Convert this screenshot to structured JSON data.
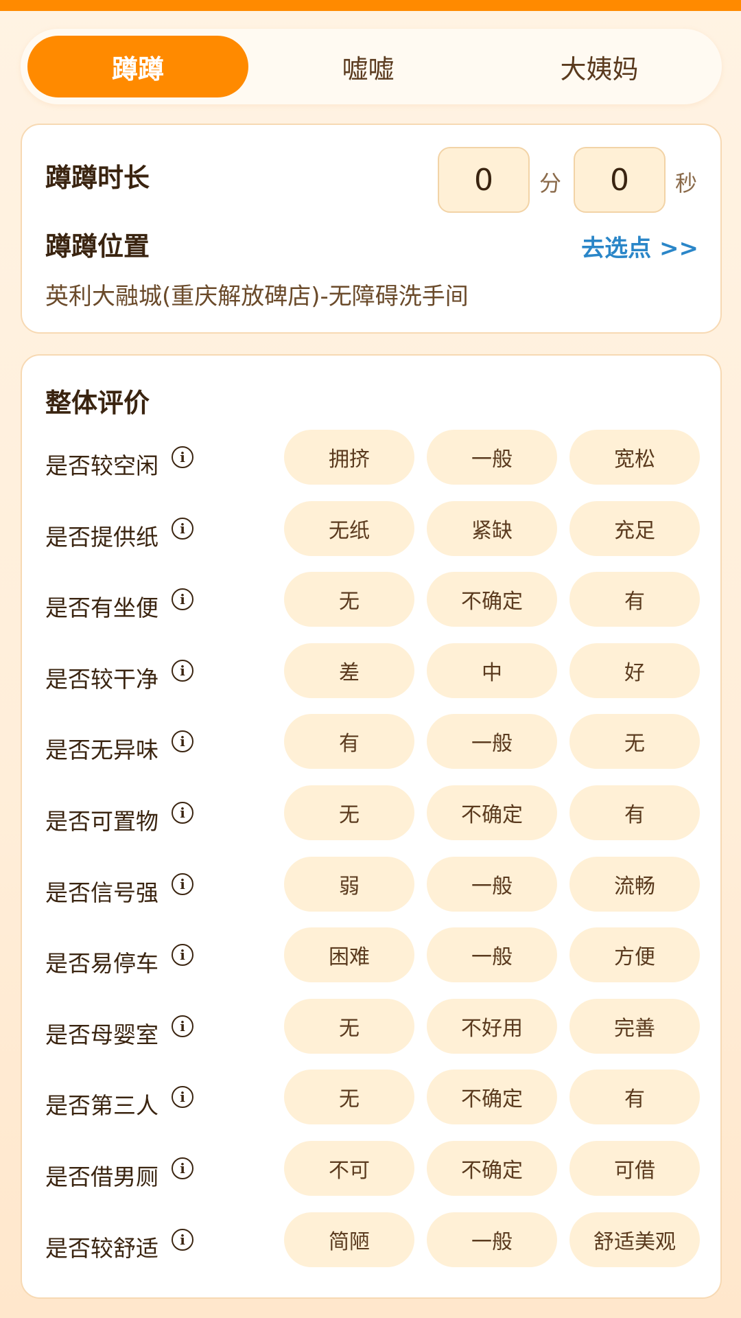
{
  "tabs": [
    {
      "label": "蹲蹲",
      "active": true
    },
    {
      "label": "嘘嘘",
      "active": false
    },
    {
      "label": "大姨妈",
      "active": false
    }
  ],
  "info": {
    "duration_label": "蹲蹲时长",
    "minutes_value": "0",
    "minutes_unit": "分",
    "seconds_value": "0",
    "seconds_unit": "秒",
    "location_label": "蹲蹲位置",
    "choose_link": "去选点 >>",
    "location_text": "英利大融城(重庆解放碑店)-无障碍洗手间"
  },
  "review": {
    "title": "整体评价",
    "criteria": [
      {
        "label": "是否较空闲",
        "options": [
          "拥挤",
          "一般",
          "宽松"
        ]
      },
      {
        "label": "是否提供纸",
        "options": [
          "无纸",
          "紧缺",
          "充足"
        ]
      },
      {
        "label": "是否有坐便",
        "options": [
          "无",
          "不确定",
          "有"
        ]
      },
      {
        "label": "是否较干净",
        "options": [
          "差",
          "中",
          "好"
        ]
      },
      {
        "label": "是否无异味",
        "options": [
          "有",
          "一般",
          "无"
        ]
      },
      {
        "label": "是否可置物",
        "options": [
          "无",
          "不确定",
          "有"
        ]
      },
      {
        "label": "是否信号强",
        "options": [
          "弱",
          "一般",
          "流畅"
        ]
      },
      {
        "label": "是否易停车",
        "options": [
          "困难",
          "一般",
          "方便"
        ]
      },
      {
        "label": "是否母婴室",
        "options": [
          "无",
          "不好用",
          "完善"
        ]
      },
      {
        "label": "是否第三人",
        "options": [
          "无",
          "不确定",
          "有"
        ]
      },
      {
        "label": "是否借男厕",
        "options": [
          "不可",
          "不确定",
          "可借"
        ]
      },
      {
        "label": "是否较舒适",
        "options": [
          "简陋",
          "一般",
          "舒适美观"
        ]
      }
    ]
  },
  "colors": {
    "accent": "#ff8a00",
    "link": "#2a86c8",
    "option_bg": "#fff0d6"
  }
}
